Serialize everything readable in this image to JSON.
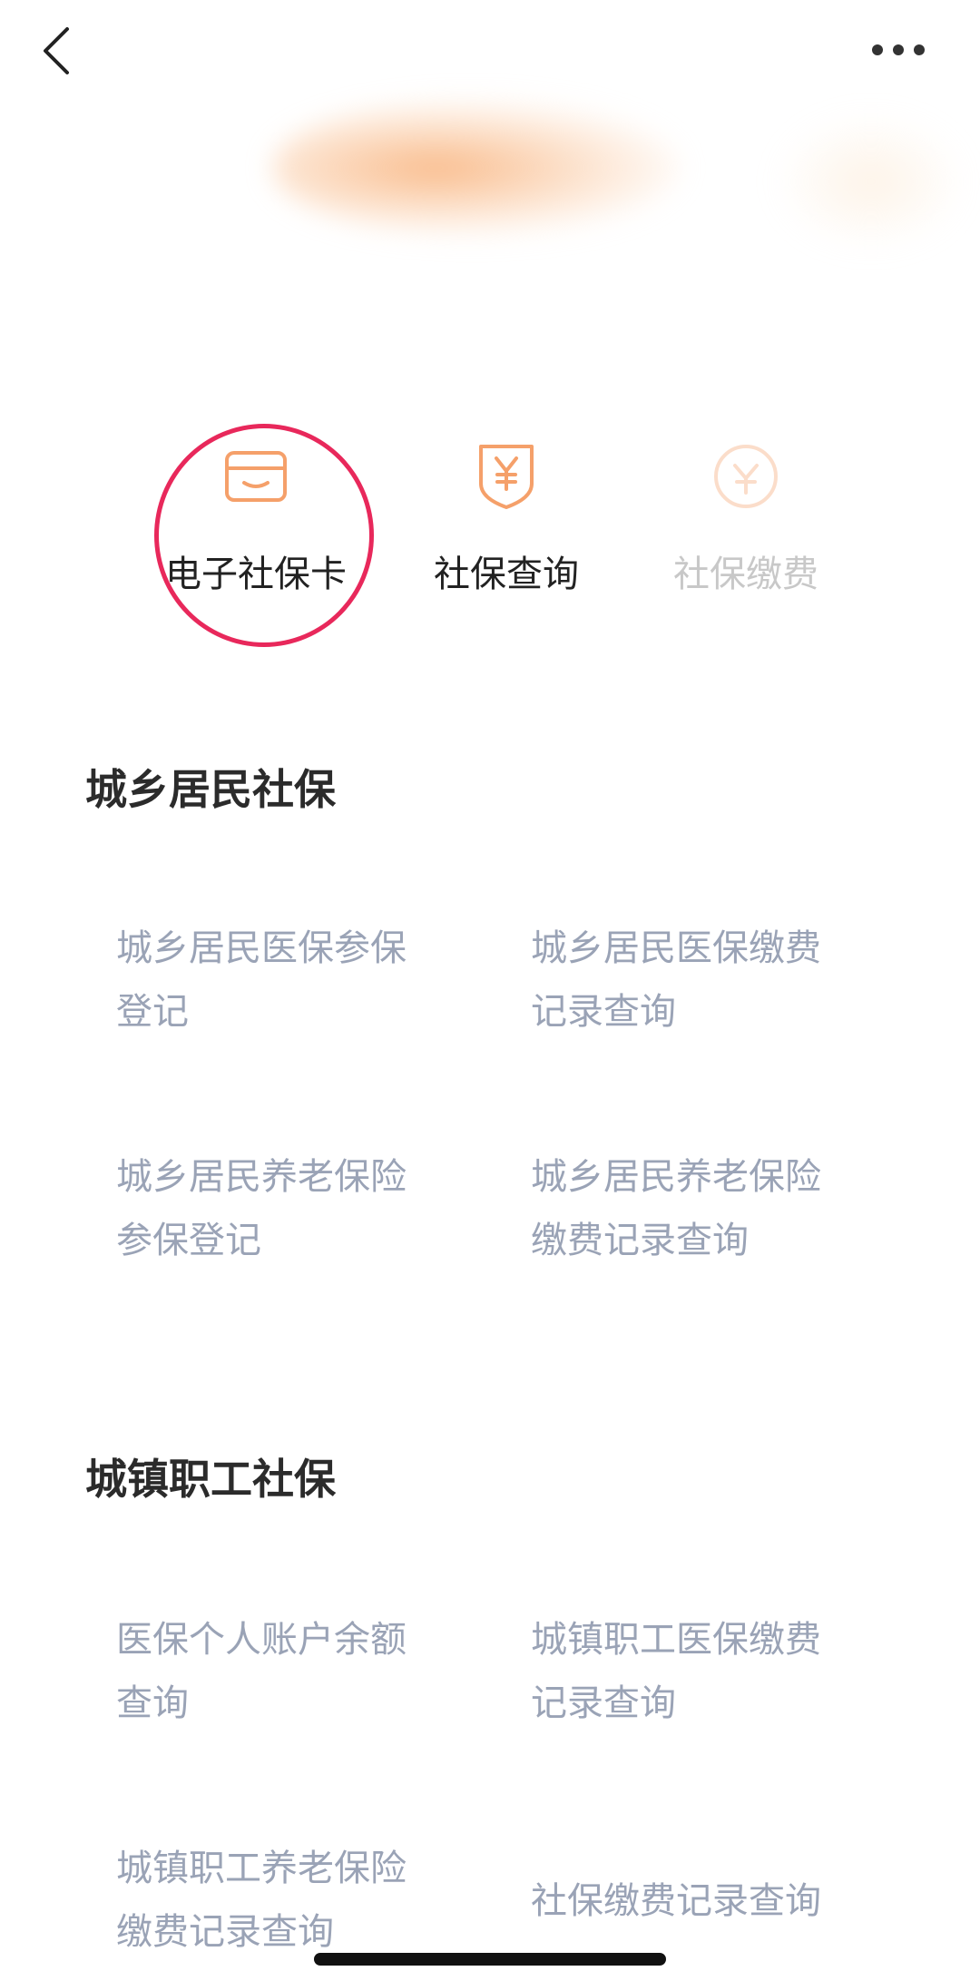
{
  "quick_entries": [
    {
      "label": "电子社保卡",
      "icon": "card-icon"
    },
    {
      "label": "社保查询",
      "icon": "shield-yuan-icon"
    },
    {
      "label": "社保缴费",
      "icon": "payment-icon"
    }
  ],
  "sections": [
    {
      "title": "城乡居民社保",
      "items": [
        {
          "line1": "城乡居民医保参保",
          "line2": "登记"
        },
        {
          "line1": "城乡居民医保缴费",
          "line2": "记录查询"
        },
        {
          "line1": "城乡居民养老保险",
          "line2": "参保登记"
        },
        {
          "line1": "城乡居民养老保险",
          "line2": "缴费记录查询"
        }
      ]
    },
    {
      "title": "城镇职工社保",
      "items": [
        {
          "line1": "医保个人账户余额",
          "line2": "查询"
        },
        {
          "line1": "城镇职工医保缴费",
          "line2": "记录查询"
        },
        {
          "line1": "城镇职工养老保险",
          "line2": "缴费记录查询"
        },
        {
          "line1": "社保缴费记录查询",
          "line2": ""
        }
      ]
    }
  ],
  "colors": {
    "accent": "#f5a06a",
    "highlight": "#e8285b",
    "item_text": "#9aa3b6"
  }
}
